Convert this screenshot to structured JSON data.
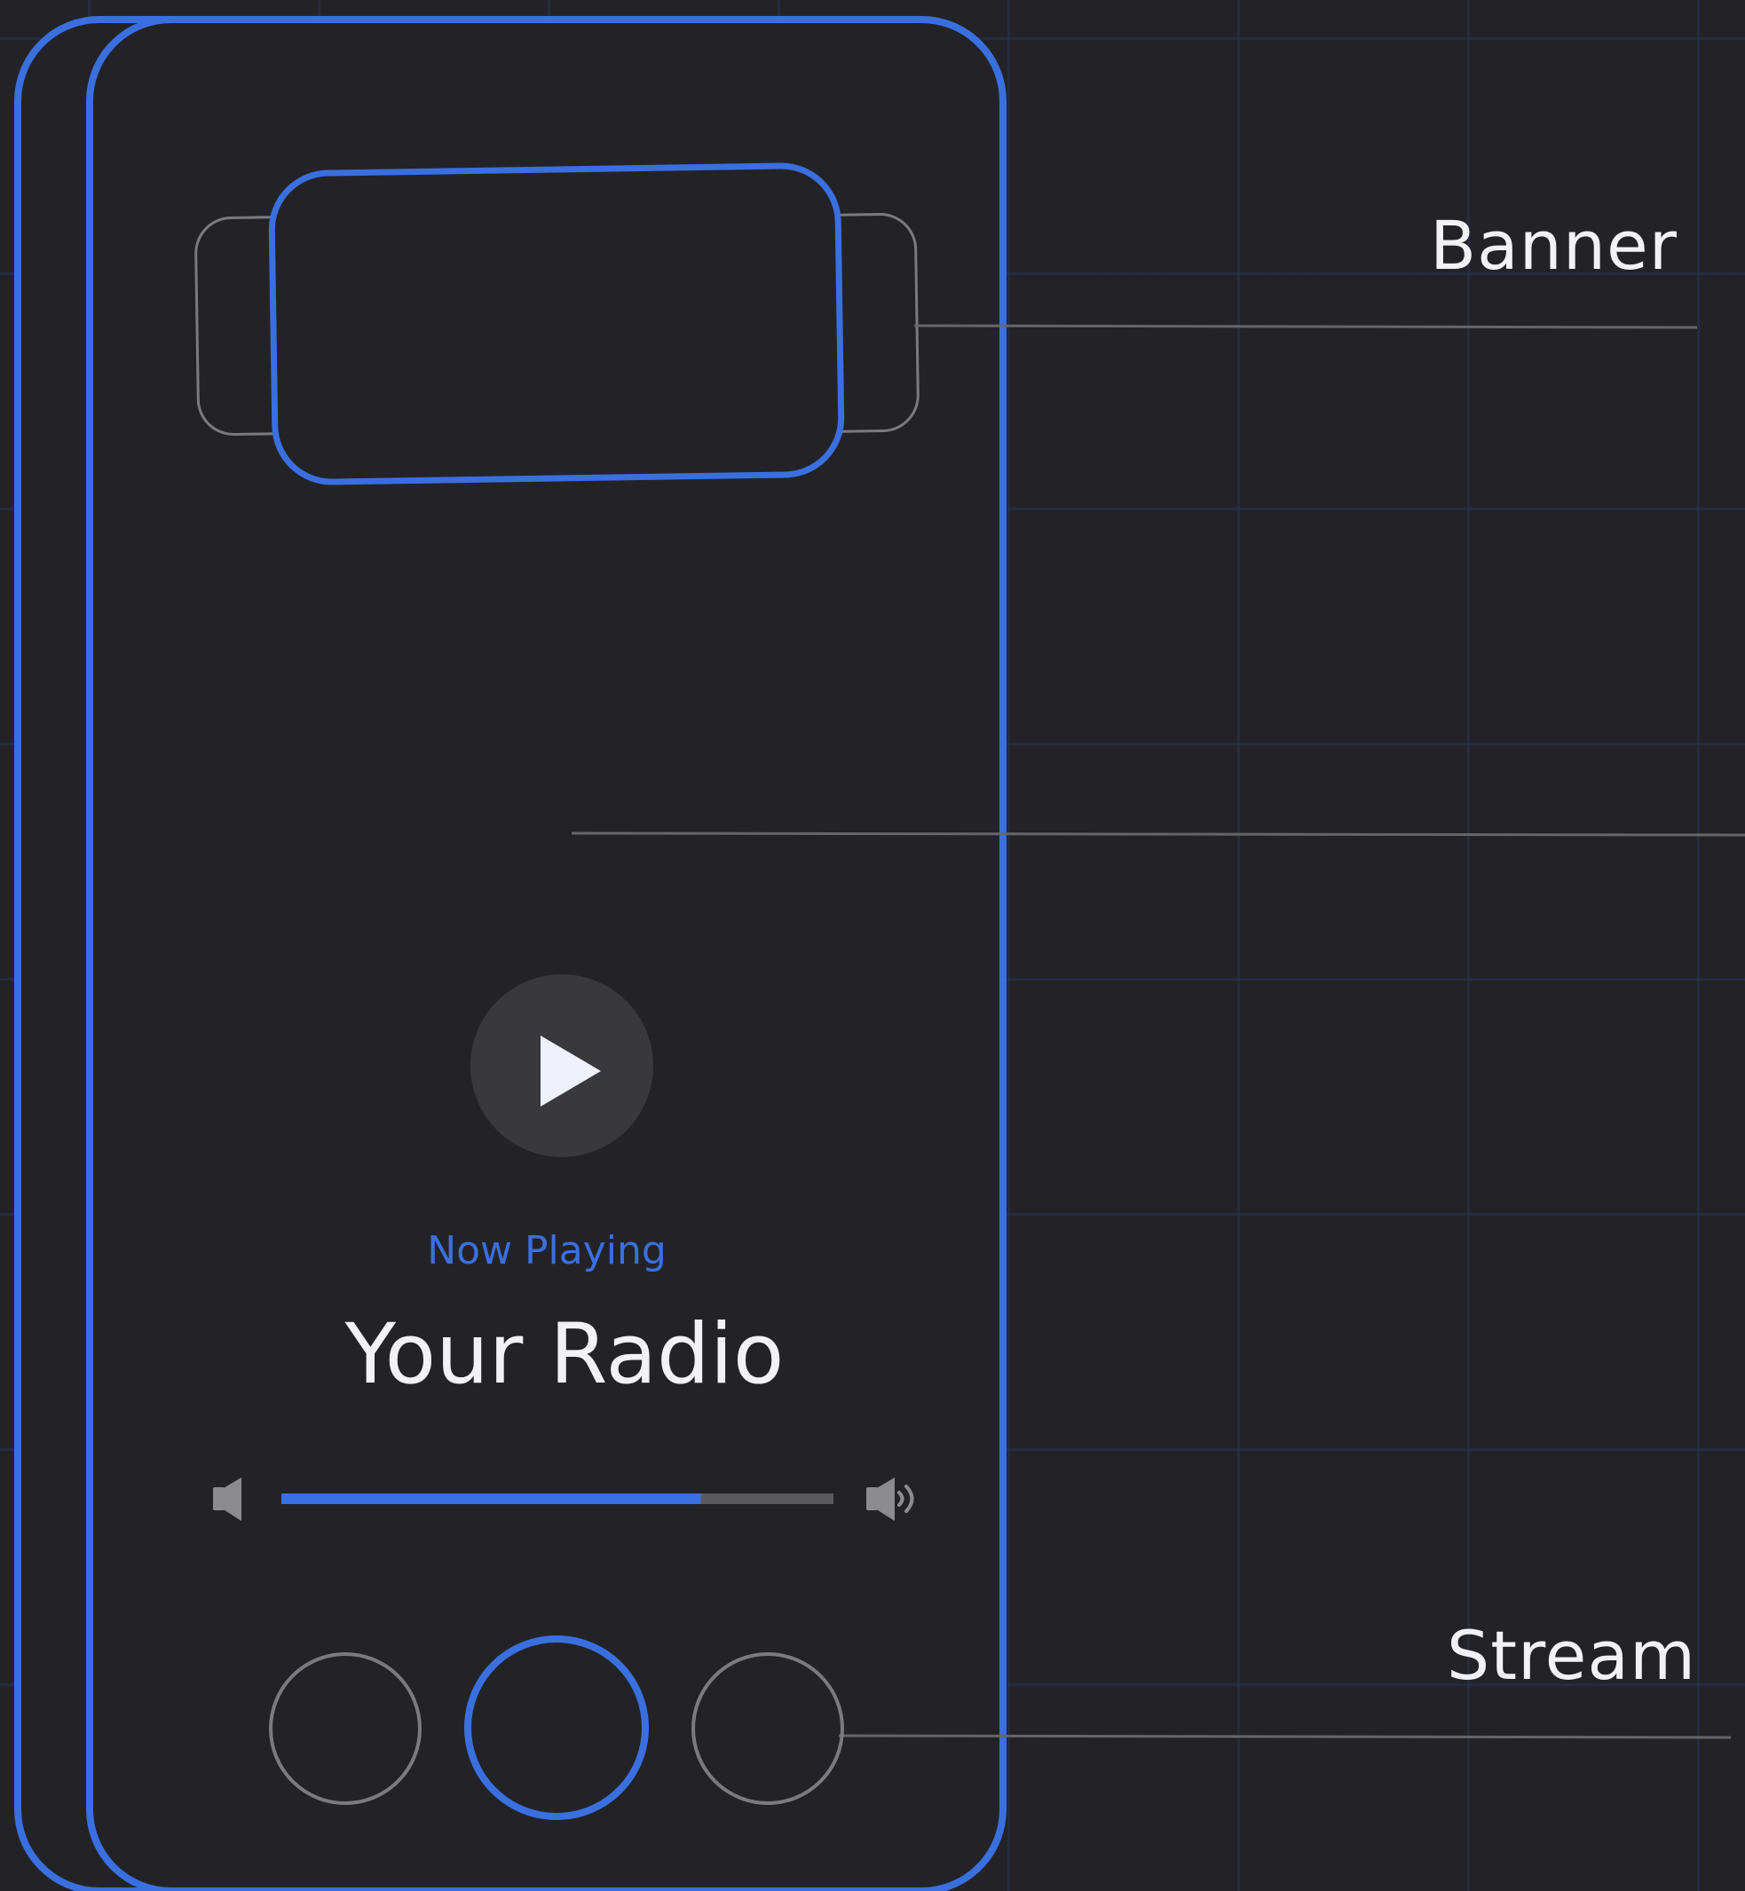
{
  "callouts": {
    "banner": "Banner",
    "stream": "Stream"
  },
  "player": {
    "now_playing_label": "Now Playing",
    "station_name": "Your Radio",
    "volume_level": 0.76
  },
  "icons": {
    "play": "play-icon",
    "volume_low": "volume-low-icon",
    "volume_high": "volume-high-icon"
  },
  "colors": {
    "background": "#232327",
    "accent": "#3a6fe0",
    "outline": "#7a7a80",
    "text": "#f1f1f6",
    "track": "#5a5a5e"
  }
}
